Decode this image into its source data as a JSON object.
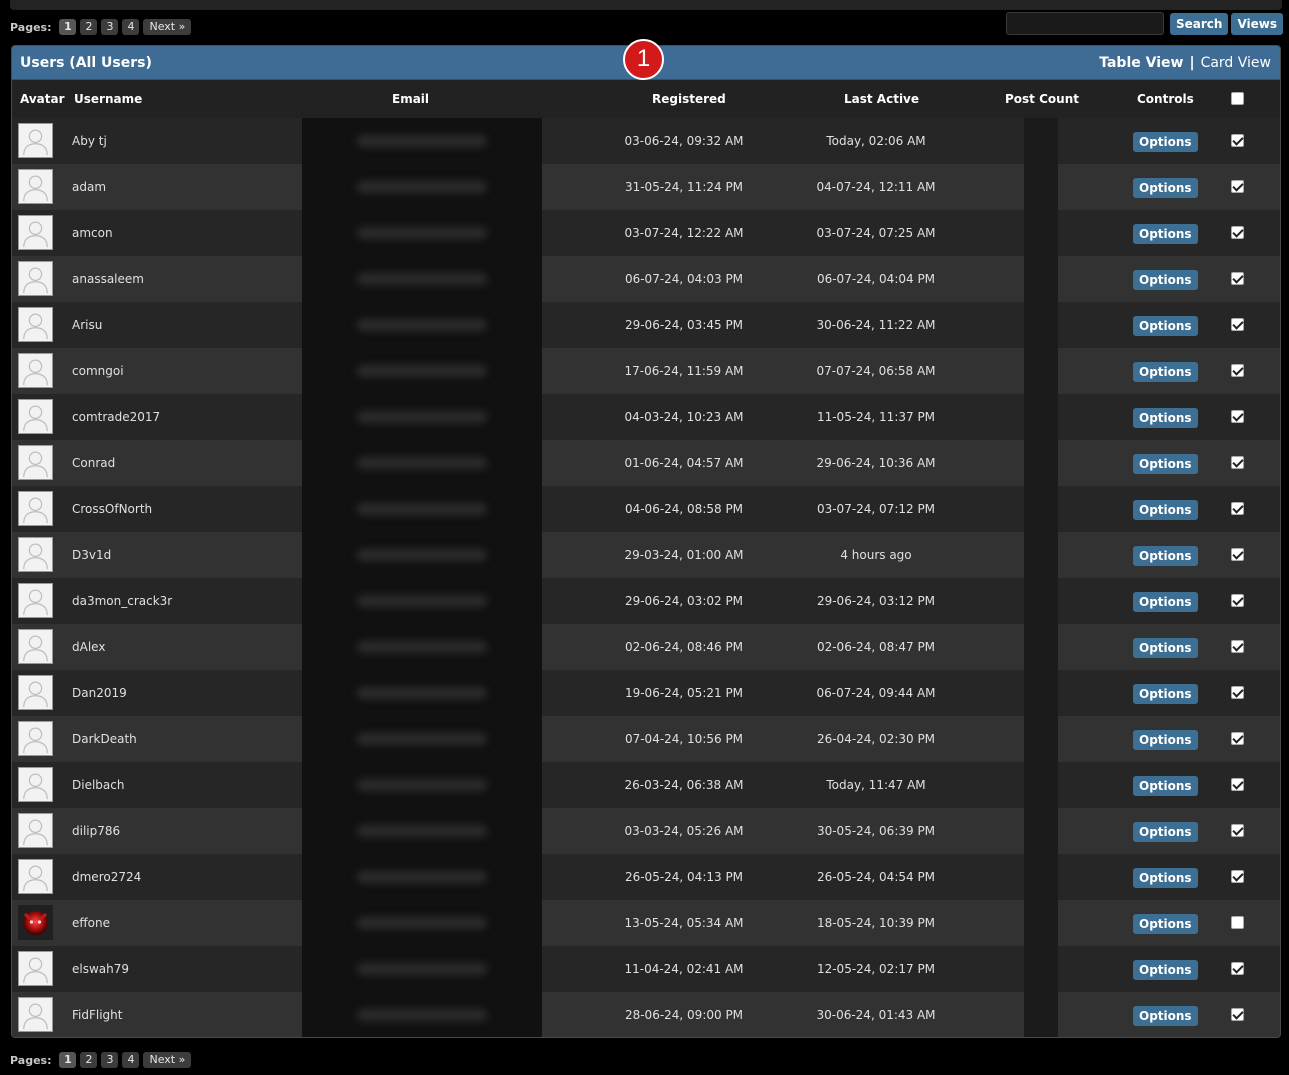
{
  "pagination": {
    "label": "Pages:",
    "pages": [
      "1",
      "2",
      "3",
      "4"
    ],
    "current": "1",
    "next_label": "Next »"
  },
  "search": {
    "value": "",
    "button_label": "Search",
    "views_label": "Views"
  },
  "panel": {
    "title": "Users (All Users)",
    "table_view_label": "Table View",
    "separator": "|",
    "card_view_label": "Card View",
    "annotation_badge": "1"
  },
  "columns": {
    "avatar": "Avatar",
    "username": "Username",
    "email": "Email",
    "registered": "Registered",
    "last_active": "Last Active",
    "post_count": "Post Count",
    "controls": "Controls"
  },
  "options_label": "Options",
  "header_checkbox_checked": false,
  "users": [
    {
      "username": "Aby tj",
      "registered": "03-06-24, 09:32 AM",
      "last_active": "Today, 02:06 AM",
      "checked": true,
      "avatar": "default"
    },
    {
      "username": "adam",
      "registered": "31-05-24, 11:24 PM",
      "last_active": "04-07-24, 12:11 AM",
      "checked": true,
      "avatar": "default"
    },
    {
      "username": "amcon",
      "registered": "03-07-24, 12:22 AM",
      "last_active": "03-07-24, 07:25 AM",
      "checked": true,
      "avatar": "default"
    },
    {
      "username": "anassaleem",
      "registered": "06-07-24, 04:03 PM",
      "last_active": "06-07-24, 04:04 PM",
      "checked": true,
      "avatar": "default"
    },
    {
      "username": "Arisu",
      "registered": "29-06-24, 03:45 PM",
      "last_active": "30-06-24, 11:22 AM",
      "checked": true,
      "avatar": "default"
    },
    {
      "username": "comngoi",
      "registered": "17-06-24, 11:59 AM",
      "last_active": "07-07-24, 06:58 AM",
      "checked": true,
      "avatar": "default"
    },
    {
      "username": "comtrade2017",
      "registered": "04-03-24, 10:23 AM",
      "last_active": "11-05-24, 11:37 PM",
      "checked": true,
      "avatar": "default"
    },
    {
      "username": "Conrad",
      "registered": "01-06-24, 04:57 AM",
      "last_active": "29-06-24, 10:36 AM",
      "checked": true,
      "avatar": "default"
    },
    {
      "username": "CrossOfNorth",
      "registered": "04-06-24, 08:58 PM",
      "last_active": "03-07-24, 07:12 PM",
      "checked": true,
      "avatar": "default"
    },
    {
      "username": "D3v1d",
      "registered": "29-03-24, 01:00 AM",
      "last_active": "4 hours ago",
      "checked": true,
      "avatar": "default"
    },
    {
      "username": "da3mon_crack3r",
      "registered": "29-06-24, 03:02 PM",
      "last_active": "29-06-24, 03:12 PM",
      "checked": true,
      "avatar": "default"
    },
    {
      "username": "dAlex",
      "registered": "02-06-24, 08:46 PM",
      "last_active": "02-06-24, 08:47 PM",
      "checked": true,
      "avatar": "default"
    },
    {
      "username": "Dan2019",
      "registered": "19-06-24, 05:21 PM",
      "last_active": "06-07-24, 09:44 AM",
      "checked": true,
      "avatar": "default"
    },
    {
      "username": "DarkDeath",
      "registered": "07-04-24, 10:56 PM",
      "last_active": "26-04-24, 02:30 PM",
      "checked": true,
      "avatar": "default"
    },
    {
      "username": "Dielbach",
      "registered": "26-03-24, 06:38 AM",
      "last_active": "Today, 11:47 AM",
      "checked": true,
      "avatar": "default"
    },
    {
      "username": "dilip786",
      "registered": "03-03-24, 05:26 AM",
      "last_active": "30-05-24, 06:39 PM",
      "checked": true,
      "avatar": "default"
    },
    {
      "username": "dmero2724",
      "registered": "26-05-24, 04:13 PM",
      "last_active": "26-05-24, 04:54 PM",
      "checked": true,
      "avatar": "default"
    },
    {
      "username": "effone",
      "registered": "13-05-24, 05:34 AM",
      "last_active": "18-05-24, 10:39 PM",
      "checked": false,
      "avatar": "custom"
    },
    {
      "username": "elswah79",
      "registered": "11-04-24, 02:41 AM",
      "last_active": "12-05-24, 02:17 PM",
      "checked": true,
      "avatar": "default"
    },
    {
      "username": "FidFlight",
      "registered": "28-06-24, 09:00 PM",
      "last_active": "30-06-24, 01:43 AM",
      "checked": true,
      "avatar": "default"
    }
  ],
  "colors": {
    "accent": "#3e6c94",
    "button": "#3d6f94",
    "badge": "#d31a1a"
  }
}
